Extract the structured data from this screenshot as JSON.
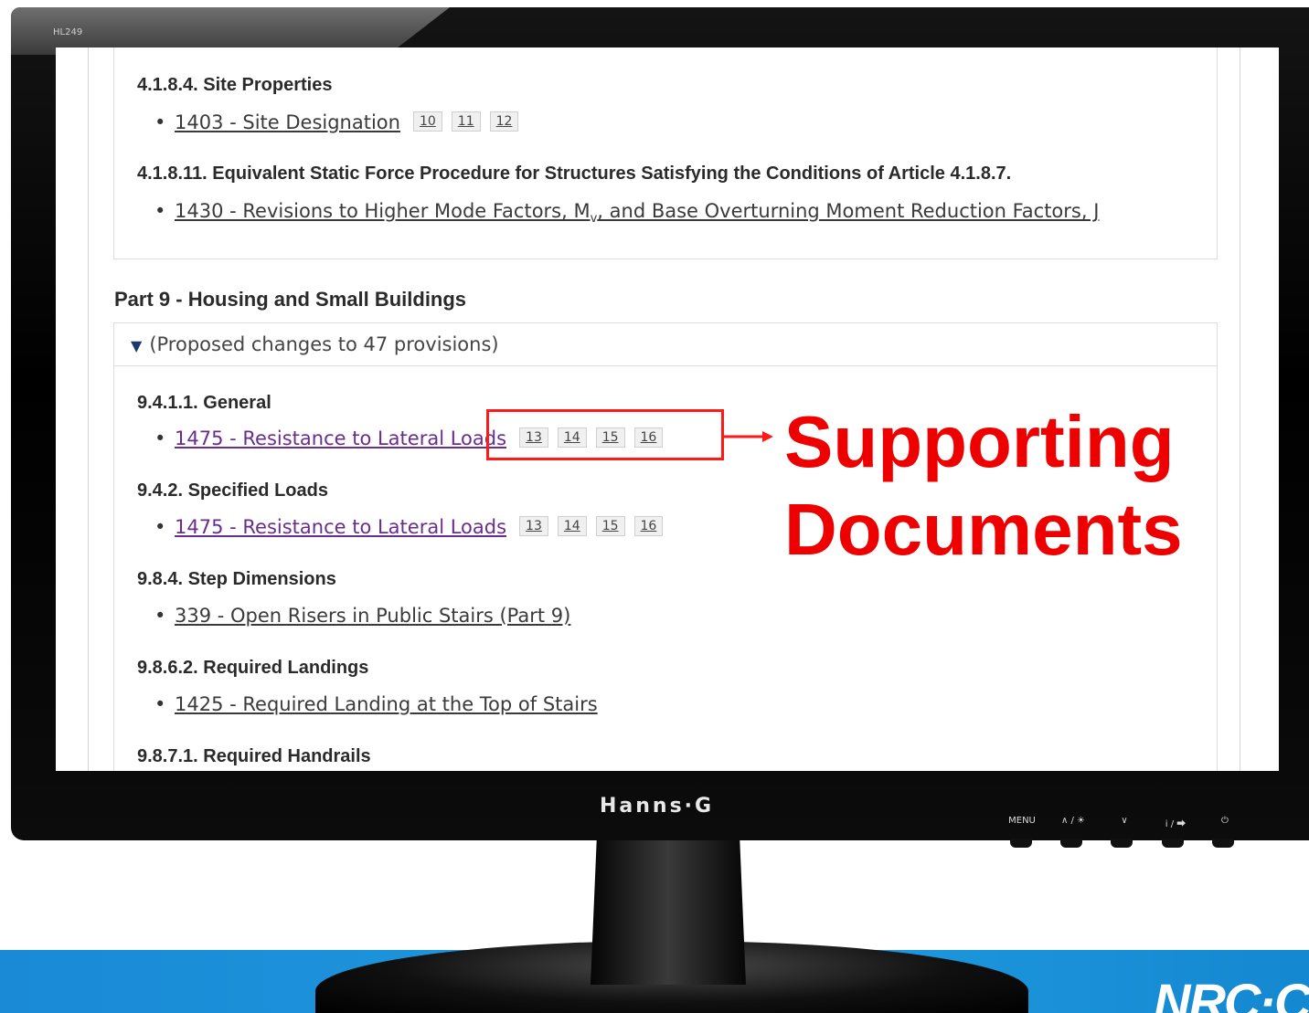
{
  "monitor": {
    "model": "HL249",
    "brand": "Hanns·G",
    "controls": [
      "MENU",
      "∧ / ☀",
      "∨",
      "i / ⮕",
      "⏻"
    ]
  },
  "footer_logo": "NRC·C",
  "content": {
    "s1_heading": "4.1.8.4. Site Properties",
    "s1_link": "1403 - Site Designation",
    "s1_docs": [
      "10",
      "11",
      "12"
    ],
    "s2_heading": "4.1.8.11. Equivalent Static Force Procedure for Structures Satisfying the Conditions of Article 4.1.8.7.",
    "s2_link_a": "1430 - Revisions to Higher Mode Factors, M",
    "s2_link_sub": "v",
    "s2_link_b": ", and Base Overturning Moment Reduction Factors, J",
    "part9_title": "Part 9 - Housing and Small Buildings",
    "part9_toggle": "(Proposed changes to 47 provisions)",
    "s3_heading": "9.4.1.1. General",
    "s3_link": "1475 - Resistance to Lateral Loads",
    "s3_docs": [
      "13",
      "14",
      "15",
      "16"
    ],
    "s4_heading": "9.4.2. Specified Loads",
    "s4_link": "1475 - Resistance to Lateral Loads",
    "s4_docs": [
      "13",
      "14",
      "15",
      "16"
    ],
    "s5_heading": "9.8.4. Step Dimensions",
    "s5_link": "339 - Open Risers in Public Stairs (Part 9)",
    "s6_heading": "9.8.6.2. Required Landings",
    "s6_link": "1425 - Required Landing at the Top of Stairs",
    "s7_heading": "9.8.7.1. Required Handrails"
  },
  "annotation": {
    "line1": "Supporting",
    "line2": "Documents",
    "color": "#ee0000"
  }
}
